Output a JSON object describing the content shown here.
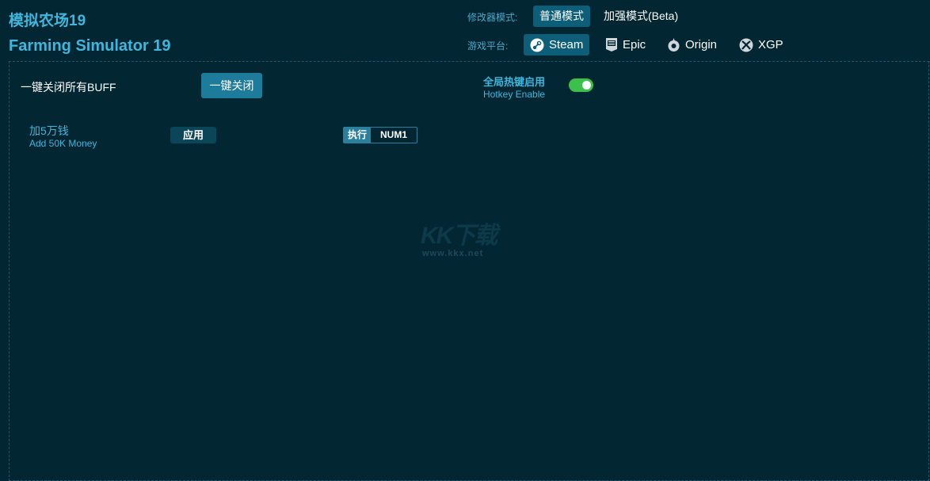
{
  "header": {
    "title_zh": "模拟农场19",
    "title_en": "Farming Simulator 19"
  },
  "mode": {
    "label": "修改器模式:",
    "normal": "普通模式",
    "beta": "加强模式(Beta)"
  },
  "platform": {
    "label": "游戏平台:",
    "options": [
      {
        "label": "Steam",
        "icon": "steam-icon",
        "active": true
      },
      {
        "label": "Epic",
        "icon": "epic-icon",
        "active": false
      },
      {
        "label": "Origin",
        "icon": "origin-icon",
        "active": false
      },
      {
        "label": "XGP",
        "icon": "xbox-icon",
        "active": false
      }
    ]
  },
  "controls": {
    "close_all_label": "一键关闭所有BUFF",
    "close_all_button": "一键关闭",
    "hotkey_zh": "全局热键启用",
    "hotkey_en": "Hotkey Enable",
    "hotkey_enabled": true
  },
  "cheats": [
    {
      "name_zh": "加5万钱",
      "name_en": "Add 50K Money",
      "apply": "应用",
      "exec_tag": "执行",
      "hotkey": "NUM1"
    }
  ],
  "watermark": {
    "logo": "KK下载",
    "url": "www.kkx.net"
  },
  "colors": {
    "background": "#032633",
    "accent": "#3fb6dc",
    "button": "#0c5e79",
    "toggle_on": "#3cc04a"
  }
}
